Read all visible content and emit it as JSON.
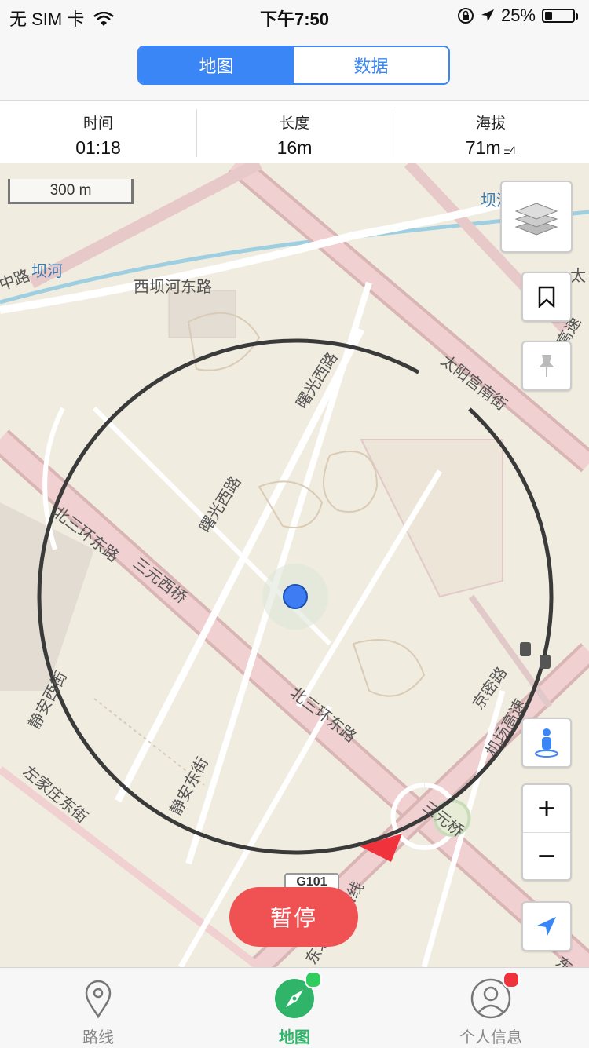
{
  "status_bar": {
    "carrier": "无 SIM 卡",
    "time": "下午7:50",
    "battery": "25%",
    "battery_level": 0.25
  },
  "segmented": {
    "options": [
      "地图",
      "数据"
    ],
    "selected": "地图"
  },
  "stats": [
    {
      "label": "时间",
      "value": "01:18",
      "sub": ""
    },
    {
      "label": "长度",
      "value": "16m",
      "sub": ""
    },
    {
      "label": "海拔",
      "value": "71m",
      "sub": "±4"
    }
  ],
  "map": {
    "scale": "300 m",
    "road_labels": [
      "西坝河东路",
      "坝河",
      "坝河",
      "中路",
      "太阳宫南街",
      "曙光西路",
      "曙光西路",
      "北三环东路",
      "三元西桥",
      "北三环东路",
      "静安西街",
      "静安东街",
      "左家庄东街",
      "三元桥",
      "京密路",
      "机场高速",
      "京承高速",
      "东北环铁路线",
      "太",
      "东北"
    ],
    "shield": "G101",
    "pause_label": "暂停"
  },
  "map_controls": {
    "layers_icon": "layers-icon",
    "bookmark_icon": "bookmark-icon",
    "pin_icon": "pin-icon",
    "person_icon": "person-icon",
    "zoom_in": "+",
    "zoom_out": "−",
    "locate_icon": "locate-arrow-icon"
  },
  "tabs": [
    {
      "label": "路线",
      "icon": "route-pin-icon",
      "active": false
    },
    {
      "label": "地图",
      "icon": "compass-icon",
      "active": true
    },
    {
      "label": "个人信息",
      "icon": "user-icon",
      "active": false
    }
  ],
  "colors": {
    "accent": "#3a86f7",
    "pause": "#f05254",
    "active_tab": "#2fb46a",
    "badge_green": "#2fcd5e",
    "badge_red": "#f0323c"
  }
}
